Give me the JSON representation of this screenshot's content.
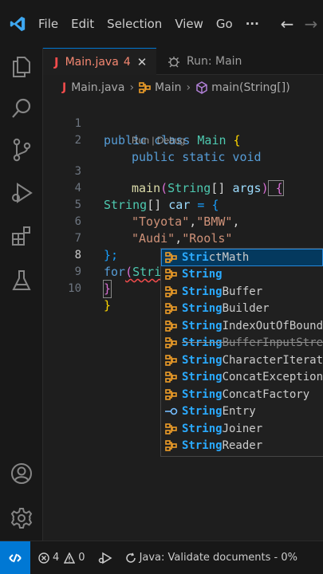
{
  "menu": {
    "items": [
      "File",
      "Edit",
      "Selection",
      "View",
      "Go"
    ],
    "more": "···"
  },
  "tabs": {
    "active": {
      "icon_text": "J",
      "label": "Main.java",
      "problem_count": "4"
    },
    "inactive": {
      "label": "Run: Main"
    }
  },
  "breadcrumb": {
    "file_icon_text": "J",
    "file": "Main.java",
    "class_name": "Main",
    "method": "main(String[])"
  },
  "editor": {
    "line_numbers": [
      "1",
      "2",
      "3",
      "4",
      "5",
      "6",
      "7",
      "8",
      "9",
      "10"
    ],
    "current_line": "8",
    "lines": {
      "l1_kw": "public class ",
      "l1_cls": "Main",
      "l1_brace": " {",
      "l2_kw": "public static void",
      "codelens": "Run | Debug",
      "l3_fn": "main",
      "l3_paren_open": "(",
      "l3_type": "String",
      "l3_brackets": "[] ",
      "l3_var": "args",
      "l3_paren_close": ")",
      "l3_brace": " {",
      "l4_type": "String",
      "l4_brackets": "[] ",
      "l4_var": "car",
      "l4_eq": " = {",
      "l5_s1": "\"Toyota\"",
      "l5_c1": ",",
      "l5_s2": "\"BMW\"",
      "l5_c2": ",",
      "l6_s1": "\"Audi\"",
      "l6_c1": ",",
      "l6_s2": "\"Rools\"",
      "l7": "};",
      "l8_kw": "for",
      "l8_paren": "(",
      "l8_typed": "Stri",
      "l9": "}",
      "l10": "}"
    }
  },
  "suggestions": [
    {
      "match": "Stri",
      "rest": "ctMath",
      "kind": "class",
      "selected": true,
      "deprecated": false
    },
    {
      "match": "String",
      "rest": "",
      "kind": "class",
      "selected": false,
      "deprecated": false
    },
    {
      "match": "String",
      "rest": "Buffer",
      "kind": "class",
      "selected": false,
      "deprecated": false
    },
    {
      "match": "String",
      "rest": "Builder",
      "kind": "class",
      "selected": false,
      "deprecated": false
    },
    {
      "match": "String",
      "rest": "IndexOutOfBounds",
      "kind": "class",
      "selected": false,
      "deprecated": false
    },
    {
      "match": "String",
      "rest": "BufferInputStre",
      "kind": "class",
      "selected": false,
      "deprecated": true
    },
    {
      "match": "String",
      "rest": "CharacterIterat",
      "kind": "class",
      "selected": false,
      "deprecated": false
    },
    {
      "match": "String",
      "rest": "ConcatException",
      "kind": "class",
      "selected": false,
      "deprecated": false
    },
    {
      "match": "String",
      "rest": "ConcatFactory",
      "kind": "class",
      "selected": false,
      "deprecated": false
    },
    {
      "match": "String",
      "rest": "Entry",
      "kind": "interface",
      "selected": false,
      "deprecated": false
    },
    {
      "match": "String",
      "rest": "Joiner",
      "kind": "class",
      "selected": false,
      "deprecated": false
    },
    {
      "match": "String",
      "rest": "Reader",
      "kind": "class",
      "selected": false,
      "deprecated": false
    }
  ],
  "statusbar": {
    "errors": "4",
    "warnings": "0",
    "java_status": "Java: Validate documents - 0%"
  },
  "colors": {
    "accent": "#0078d4",
    "match_highlight": "#2aaaff",
    "class_icon": "#ee9d28",
    "interface_icon": "#75beff",
    "error": "#f14c4c"
  },
  "icons": {
    "activity": [
      "explorer-icon",
      "search-icon",
      "source-control-icon",
      "run-debug-icon",
      "extensions-icon",
      "testing-icon",
      "accounts-icon",
      "settings-gear-icon"
    ]
  }
}
